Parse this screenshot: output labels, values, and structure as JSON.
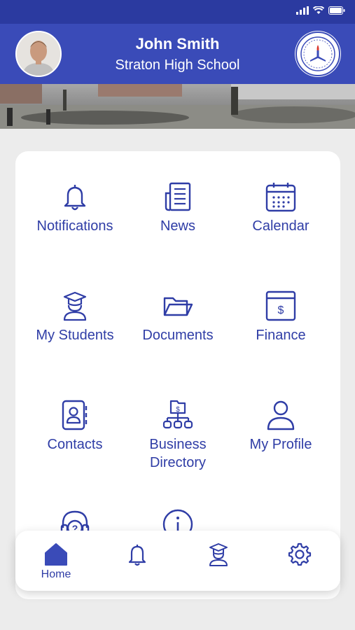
{
  "header": {
    "user_name": "John Smith",
    "school_name": "Straton High School"
  },
  "menu": [
    {
      "label": "Notifications",
      "icon": "bell-icon"
    },
    {
      "label": "News",
      "icon": "newspaper-icon"
    },
    {
      "label": "Calendar",
      "icon": "calendar-icon"
    },
    {
      "label": "My Students",
      "icon": "student-icon"
    },
    {
      "label": "Documents",
      "icon": "folder-icon"
    },
    {
      "label": "Finance",
      "icon": "finance-icon"
    },
    {
      "label": "Contacts",
      "icon": "contacts-icon"
    },
    {
      "label": "Business Directory",
      "icon": "business-directory-icon"
    },
    {
      "label": "My Profile",
      "icon": "profile-icon"
    },
    {
      "label": "",
      "icon": "help-headset-icon"
    },
    {
      "label": "",
      "icon": "info-icon"
    }
  ],
  "bottom_nav": [
    {
      "label": "Home",
      "icon": "home-icon",
      "active": true
    },
    {
      "label": "",
      "icon": "bell-icon"
    },
    {
      "label": "",
      "icon": "student-icon"
    },
    {
      "label": "",
      "icon": "gear-icon"
    }
  ],
  "colors": {
    "primary": "#3a4bb8",
    "status_bar": "#2b3aa0",
    "icon": "#2f3da6",
    "background": "#ececec"
  }
}
